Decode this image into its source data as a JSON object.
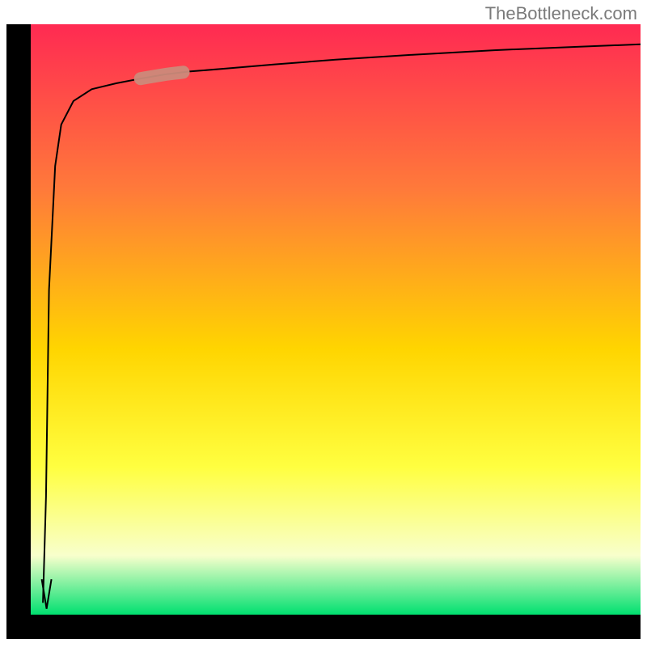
{
  "watermark": "TheBottleneck.com",
  "colors": {
    "watermark_text": "#7a7a7a",
    "axis_black": "#000000",
    "curve_black": "#000000",
    "gradient_top": "#ff2a52",
    "gradient_mid1": "#ff7a3a",
    "gradient_mid2": "#ffd500",
    "gradient_mid3": "#ffff40",
    "gradient_mid4": "#f8ffcc",
    "gradient_bottom": "#00e070",
    "marker_fill": "#cc8a7a",
    "marker_stroke": "#b06a5a"
  },
  "chart_data": {
    "type": "line",
    "title": "",
    "xlabel": "",
    "ylabel": "",
    "xlim": [
      0,
      100
    ],
    "ylim": [
      0,
      100
    ],
    "notes": "Curve values read visually from the plot. The curve runs along the left axis near y=0 at x≈2, then spikes to y≈98 as x increases, approaching an asymptote. A thick rounded highlight segment sits on the curve roughly over x∈[18,24]. Background is a vertical red→orange→yellow→pale→green gradient.",
    "series": [
      {
        "name": "curve",
        "x": [
          2,
          2.5,
          3,
          4,
          5,
          7,
          10,
          14,
          18,
          22,
          26,
          32,
          40,
          50,
          62,
          76,
          90,
          100
        ],
        "y": [
          2,
          20,
          55,
          76,
          83,
          87,
          89,
          90,
          90.8,
          91.5,
          92,
          92.5,
          93.2,
          94.0,
          94.8,
          95.6,
          96.2,
          96.6
        ]
      }
    ],
    "marker_range_x": [
      18,
      25
    ],
    "gradient_stops": [
      {
        "pct": 0,
        "hex": "#ff2a52"
      },
      {
        "pct": 28,
        "hex": "#ff7a3a"
      },
      {
        "pct": 55,
        "hex": "#ffd500"
      },
      {
        "pct": 75,
        "hex": "#ffff40"
      },
      {
        "pct": 90,
        "hex": "#f8ffcc"
      },
      {
        "pct": 100,
        "hex": "#00e070"
      }
    ]
  }
}
